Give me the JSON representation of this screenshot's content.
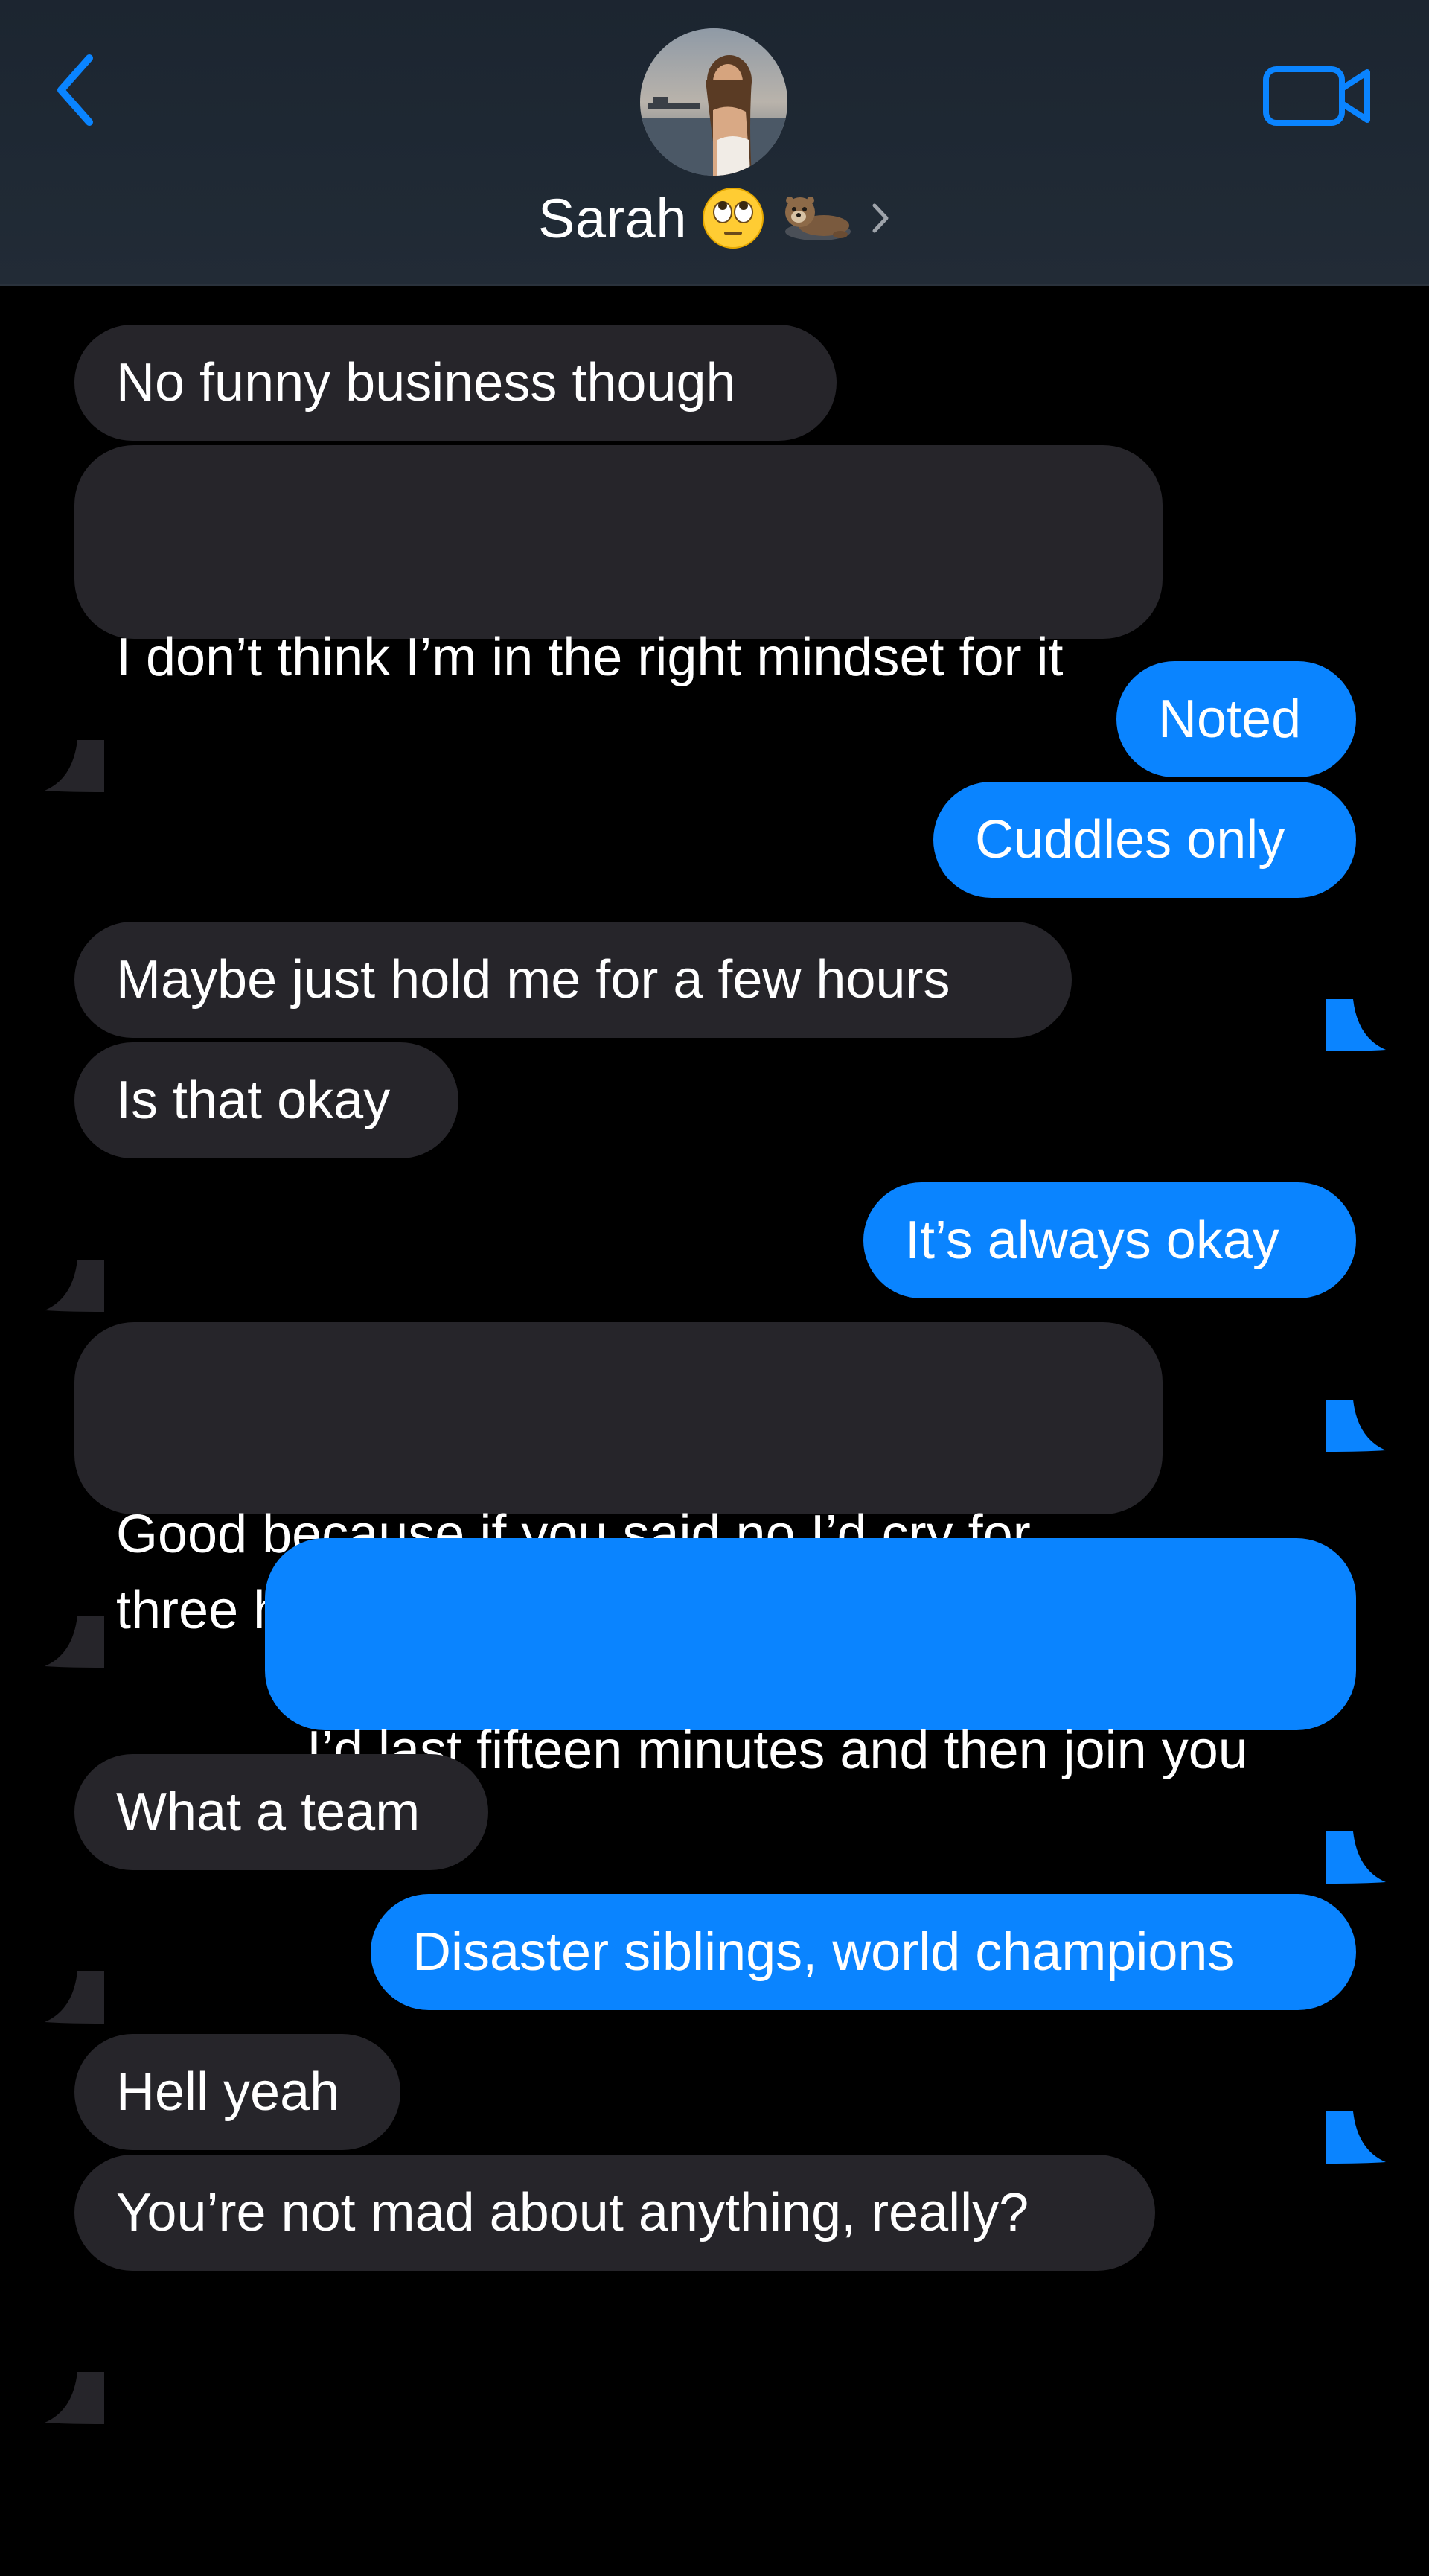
{
  "header": {
    "contact_name": "Sarah",
    "back_icon": "chevron-left-icon",
    "video_icon": "video-camera-icon",
    "name_emojis": [
      "face-with-rolling-eyes-emoji",
      "otter-emoji"
    ],
    "accent_color": "#0a84ff"
  },
  "colors": {
    "sent_bubble": "#0a84ff",
    "received_bubble": "#26252a",
    "background": "#000000",
    "header_background": "#1f2934"
  },
  "messages": [
    {
      "direction": "received",
      "text": "No funny business though"
    },
    {
      "direction": "received",
      "text": "I don’t think I’m in the right mindset for it"
    },
    {
      "direction": "sent",
      "text": "Noted"
    },
    {
      "direction": "sent",
      "text": "Cuddles only"
    },
    {
      "direction": "received",
      "text": "Maybe just hold me for a few hours"
    },
    {
      "direction": "received",
      "text": "Is that okay"
    },
    {
      "direction": "sent",
      "text": "It’s always okay"
    },
    {
      "direction": "received",
      "text": "Good because if you said no I’d cry for three hours"
    },
    {
      "direction": "sent",
      "text": "I’d last fifteen minutes and then join you"
    },
    {
      "direction": "received",
      "text": "What a team"
    },
    {
      "direction": "sent",
      "text": "Disaster siblings, world champions"
    },
    {
      "direction": "received",
      "text": "Hell yeah"
    },
    {
      "direction": "received",
      "text": "You’re not mad about anything, really?"
    }
  ]
}
